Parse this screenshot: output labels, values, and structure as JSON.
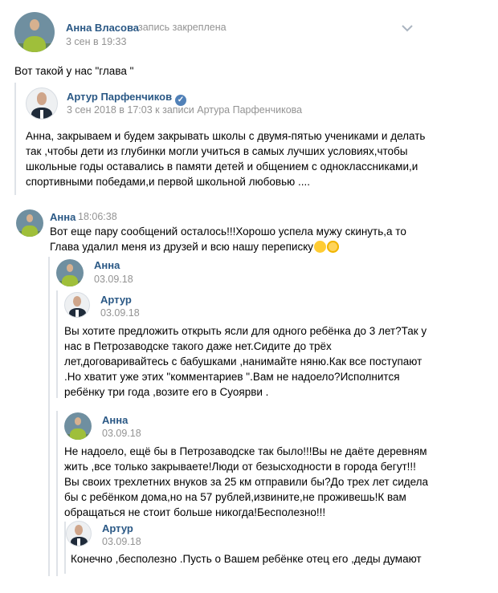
{
  "post": {
    "author": "Анна Власова",
    "pinned": "запись закреплена",
    "date": "3 сен в 19:33",
    "text": "Вот такой у нас \"глава \""
  },
  "repost": {
    "author": "Артур Парфенчиков",
    "meta": "3 сен 2018 в 17:03 к записи Артура Парфенчикова",
    "lines": [
      "Анна, закрываем и будем закрывать школы с двумя-пятью учениками и делать",
      "так ,чтобы дети из глубинки могли учиться в самых лучших условиях,чтобы",
      "школьные годы оставались в памяти детей и общением с одноклассниками,и",
      "спортивными победами,и первой школьной любовью ...."
    ]
  },
  "comment": {
    "author": "Анна",
    "time": "18:06:38",
    "lines": [
      "Вот еще пару сообщений осталось!!!Хорошо успела мужу скинуть,а то",
      "Глава удалил меня из друзей и всю нашу переписку"
    ]
  },
  "messages": [
    {
      "author": "Анна",
      "date": "03.09.18",
      "lines": []
    },
    {
      "author": "Артур",
      "date": "03.09.18",
      "lines": [
        "Вы хотите предложить открыть ясли для одного ребёнка до 3 лет?Так у",
        "нас в Петрозаводске такого даже нет.Сидите до трёх",
        "лет,договаривайтесь с бабушками ,нанимайте няню.Как все поступают",
        ".Но хватит уже этих \"комментариев \".Вам не надоело?Исполнится",
        "ребёнку три года ,возите его в Суоярви ."
      ]
    },
    {
      "author": "Анна",
      "date": "03.09.18",
      "lines": [
        "Не надоело, ещё бы в Петрозаводске так было!!!Вы не даёте деревням",
        "жить ,все только закрываете!Люди от безысходности в города бегут!!!",
        "Вы своих трехлетних внуков за 25 км отправили бы?До трех лет сидела",
        "бы с ребёнком дома,но на 57 рублей,извините,не проживешь!К вам",
        "обращаться не стоит больше никогда!Бесполезно!!!"
      ]
    },
    {
      "author": "Артур",
      "date": "03.09.18",
      "lines": [
        "Конечно ,бесполезно .Пусть о Вашем ребёнке отец его ,деды думают"
      ]
    }
  ],
  "icons": {
    "menu": "chevron-down-icon",
    "verified": "verified-check-icon",
    "emoji": [
      "smile-emoji-icon",
      "grimace-emoji-icon"
    ]
  },
  "colors": {
    "name": "#2a5885",
    "meta": "#939393",
    "divider": "#dfe3e8"
  }
}
